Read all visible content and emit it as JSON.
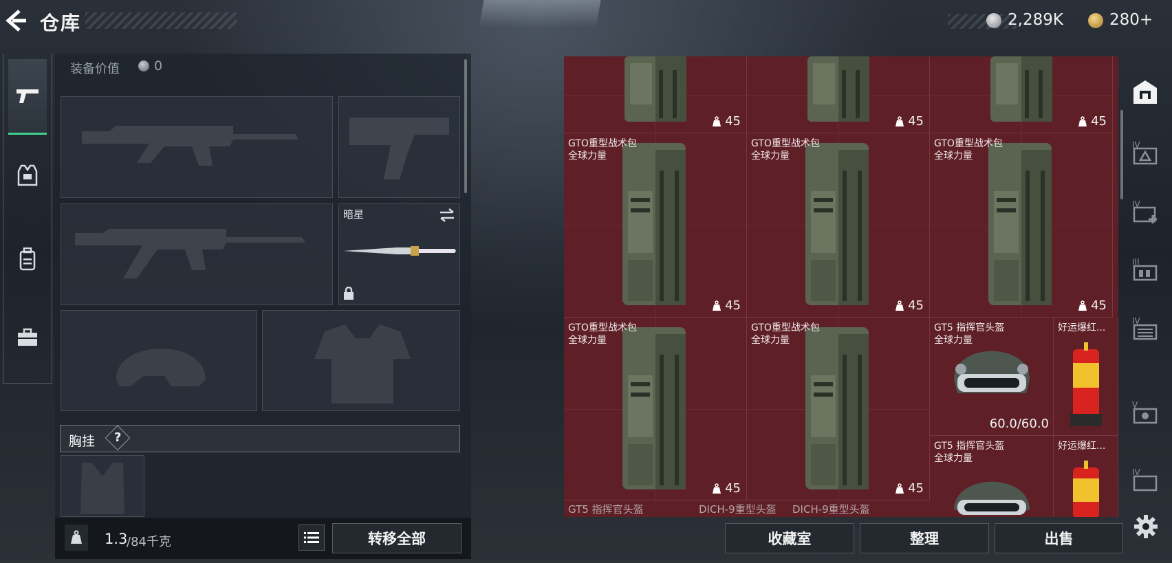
{
  "header": {
    "title": "仓库",
    "currency1": "2,289K",
    "currency2": "280+"
  },
  "colors": {
    "accent": "#3fd18a",
    "inventory_bg": "#5e1f27"
  },
  "left_tabs": [
    {
      "icon": "pistol-icon",
      "active": true
    },
    {
      "icon": "armor-vest-icon"
    },
    {
      "icon": "backpack-icon"
    },
    {
      "icon": "toolbox-icon"
    }
  ],
  "equip": {
    "value_label": "装备价值",
    "value": "0",
    "knife_name": "暗星",
    "chest_label": "胸挂",
    "help": "?"
  },
  "footer": {
    "weight_current": "1.3",
    "weight_max": "/84千克",
    "transfer_all": "转移全部"
  },
  "inventory": {
    "rows": [
      [
        {
          "name": "",
          "sub": "",
          "qty": "45",
          "type": "backpack"
        },
        {
          "name": "",
          "sub": "",
          "qty": "45",
          "type": "backpack"
        },
        {
          "name": "",
          "sub": "",
          "qty": "45",
          "type": "backpack"
        }
      ],
      [
        {
          "name": "GTO重型战术包",
          "sub": "全球力量",
          "qty": "45",
          "type": "backpack"
        },
        {
          "name": "GTO重型战术包",
          "sub": "全球力量",
          "qty": "45",
          "type": "backpack"
        },
        {
          "name": "GTO重型战术包",
          "sub": "全球力量",
          "qty": "45",
          "type": "backpack"
        }
      ],
      [
        {
          "name": "GTO重型战术包",
          "sub": "全球力量",
          "qty": "45",
          "type": "backpack"
        },
        {
          "name": "GTO重型战术包",
          "sub": "全球力量",
          "qty": "45",
          "type": "backpack"
        }
      ]
    ],
    "helmets": [
      {
        "name": "GT5 指挥官头盔",
        "sub": "全球力量",
        "durability": "60.0/60.0"
      },
      {
        "name": "GT5 指挥官头盔",
        "sub": "全球力量"
      }
    ],
    "firecrackers": [
      {
        "name": "好运爆红..."
      },
      {
        "name": "好运爆红..."
      }
    ],
    "bottom_row": [
      "GT5 指挥官头盔",
      "DICH-9重型头盔",
      "DICH-9重型头盔"
    ]
  },
  "actions": {
    "collection": "收藏室",
    "organize": "整理",
    "sell": "出售"
  },
  "right_tabs": [
    "home-base-icon",
    "IV",
    "IV",
    "III",
    "IV",
    "V",
    "IV"
  ]
}
